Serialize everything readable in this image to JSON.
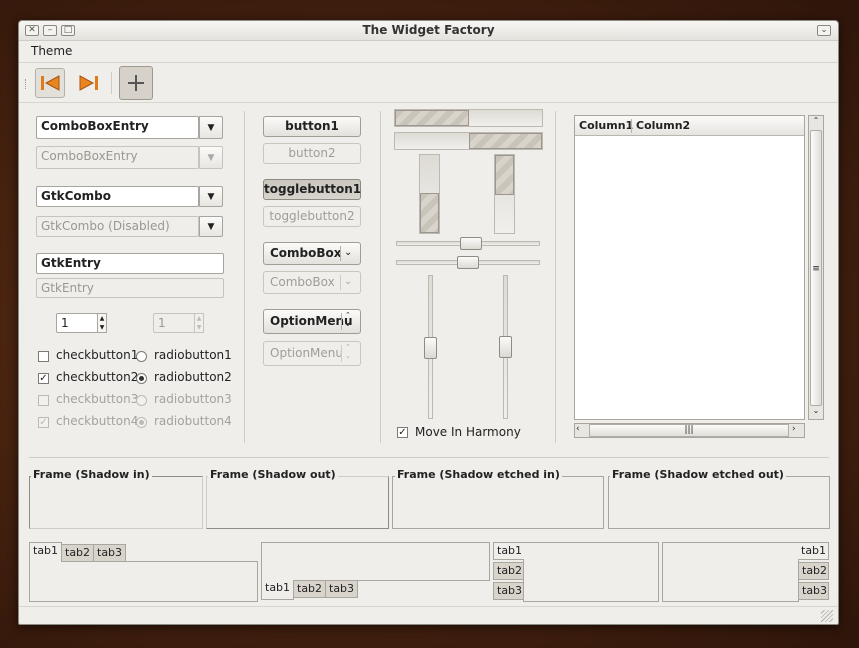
{
  "window": {
    "title": "The Widget Factory"
  },
  "menubar": {
    "theme": "Theme"
  },
  "icons": {
    "toolbar": [
      "go-first-icon",
      "go-last-icon",
      "add-icon"
    ]
  },
  "left": {
    "combo_entry": "ComboBoxEntry",
    "combo_entry_disabled": "ComboBoxEntry",
    "gtk_combo": "GtkCombo",
    "gtk_combo_disabled": "GtkCombo (Disabled)",
    "entry": "GtkEntry",
    "entry_disabled": "GtkEntry",
    "spin": "1",
    "spin_disabled": "1",
    "check1": "checkbutton1",
    "check2": "checkbutton2",
    "check3": "checkbutton3",
    "check4": "checkbutton4",
    "radio1": "radiobutton1",
    "radio2": "radiobutton2",
    "radio3": "radiobutton3",
    "radio4": "radiobutton4"
  },
  "middle": {
    "button1": "button1",
    "button2": "button2",
    "toggle1": "togglebutton1",
    "toggle2": "togglebutton2",
    "combobox": "ComboBox",
    "combobox_disabled": "ComboBox",
    "optionmenu": "OptionMenu",
    "optionmenu_disabled": "OptionMenu"
  },
  "ranges": {
    "move_in_harmony": "Move In Harmony",
    "hslider1_fraction": 0.52,
    "hslider2_fraction": 0.5,
    "vslider1_fraction": 0.5,
    "vslider2_fraction": 0.5
  },
  "tree": {
    "col1": "Column1",
    "col2": "Column2"
  },
  "frames": {
    "in": "Frame (Shadow in)",
    "out": "Frame (Shadow out)",
    "etched_in": "Frame (Shadow etched in)",
    "etched_out": "Frame (Shadow etched out)"
  },
  "tabs": {
    "t1": "tab1",
    "t2": "tab2",
    "t3": "tab3"
  }
}
